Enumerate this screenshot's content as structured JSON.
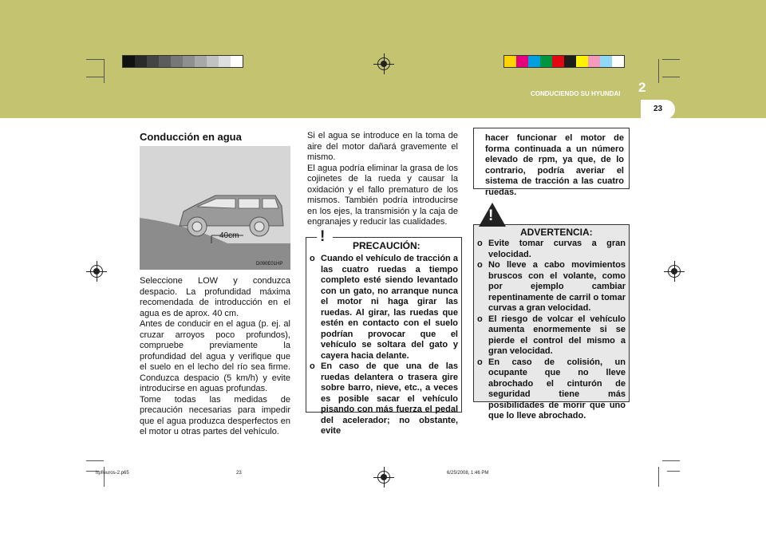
{
  "header": {
    "chapter_title": "CONDUCIENDO SU HYUNDAI",
    "chapter_number": "2",
    "page_number": "23"
  },
  "color_bars": {
    "left": [
      "#111111",
      "#2a2a2a",
      "#444444",
      "#5c5c5c",
      "#777777",
      "#8f8f8f",
      "#a8a8a8",
      "#c2c2c2",
      "#dedede",
      "#ffffff"
    ],
    "right": [
      "#ffd400",
      "#e6007e",
      "#00a0e0",
      "#009640",
      "#e30613",
      "#1d1d1b",
      "#fff200",
      "#f49ac1",
      "#8ed8f8",
      "#ffffff"
    ]
  },
  "colors": {
    "band": "#c3c370",
    "warning_bg": "#e8e8e8"
  },
  "left_col": {
    "title": "Conducción en agua",
    "figure_depth_label": "40cm",
    "figure_code": "D090E01HP",
    "paragraphs": [
      "Seleccione LOW y conduzca despacio. La profundidad máxima recomendada de introducción en el agua es de aprox. 40 cm.",
      "Antes de conducir en el agua (p. ej. al cruzar arroyos poco profundos), compruebe previamente la profundidad del agua y verifique que el suelo en el lecho del río sea firme. Conduzca despacio (5 km/h) y evite introducirse en aguas profundas.",
      "Tome todas las medidas de precaución necesarias para impedir que el agua produzca desperfectos en el motor u otras partes del vehículo."
    ]
  },
  "mid_col": {
    "paragraphs": [
      "Si el agua se introduce en la toma de aire del motor dañará gravemente el mismo.",
      "El agua podría eliminar la grasa de los cojinetes de la rueda y causar la oxidación y el fallo prematuro de los mismos. También podría introducirse en los ejes, la transmisión y la caja de engranajes y reducir las cualidades."
    ],
    "caution": {
      "title": "PRECAUCIÓN:",
      "items": [
        "Cuando el vehículo de tracción a las cuatro ruedas a tiempo completo esté siendo levantado con un gato, no arranque nunca el motor ni haga girar las ruedas. Al girar, las ruedas que estén en contacto con el suelo podrían provocar que el vehículo se soltara del gato y cayera hacia delante.",
        "En caso de que una de las ruedas delantera o trasera gire sobre barro, nieve, etc., a veces es posible sacar el vehículo pisando con más fuerza el pedal del acelerador; no obstante, evite"
      ]
    }
  },
  "right_col": {
    "continuation": "hacer funcionar el motor de forma continuada a un número elevado de rpm, ya que, de lo contrario, podría averiar el sistema de tracción a las cuatro ruedas.",
    "warning": {
      "title": "ADVERTENCIA:",
      "items": [
        "Evite tomar curvas a gran velocidad.",
        "No lleve a cabo movimientos bruscos con el volante, como por ejemplo cambiar repentinamente de carril o tomar curvas a gran velocidad.",
        "El riesgo de volcar el vehículo aumenta enormemente si se pierde el control del mismo a gran velocidad.",
        "En caso de colisión, un ocupante que no lleve abrochado el cinturón de seguridad tiene más posibilidades de morir que uno que lo lleve abrochado."
      ]
    }
  },
  "footer": {
    "file": "hpfleuros-2.p65",
    "page": "23",
    "datetime": "6/25/2008, 1:46 PM"
  }
}
